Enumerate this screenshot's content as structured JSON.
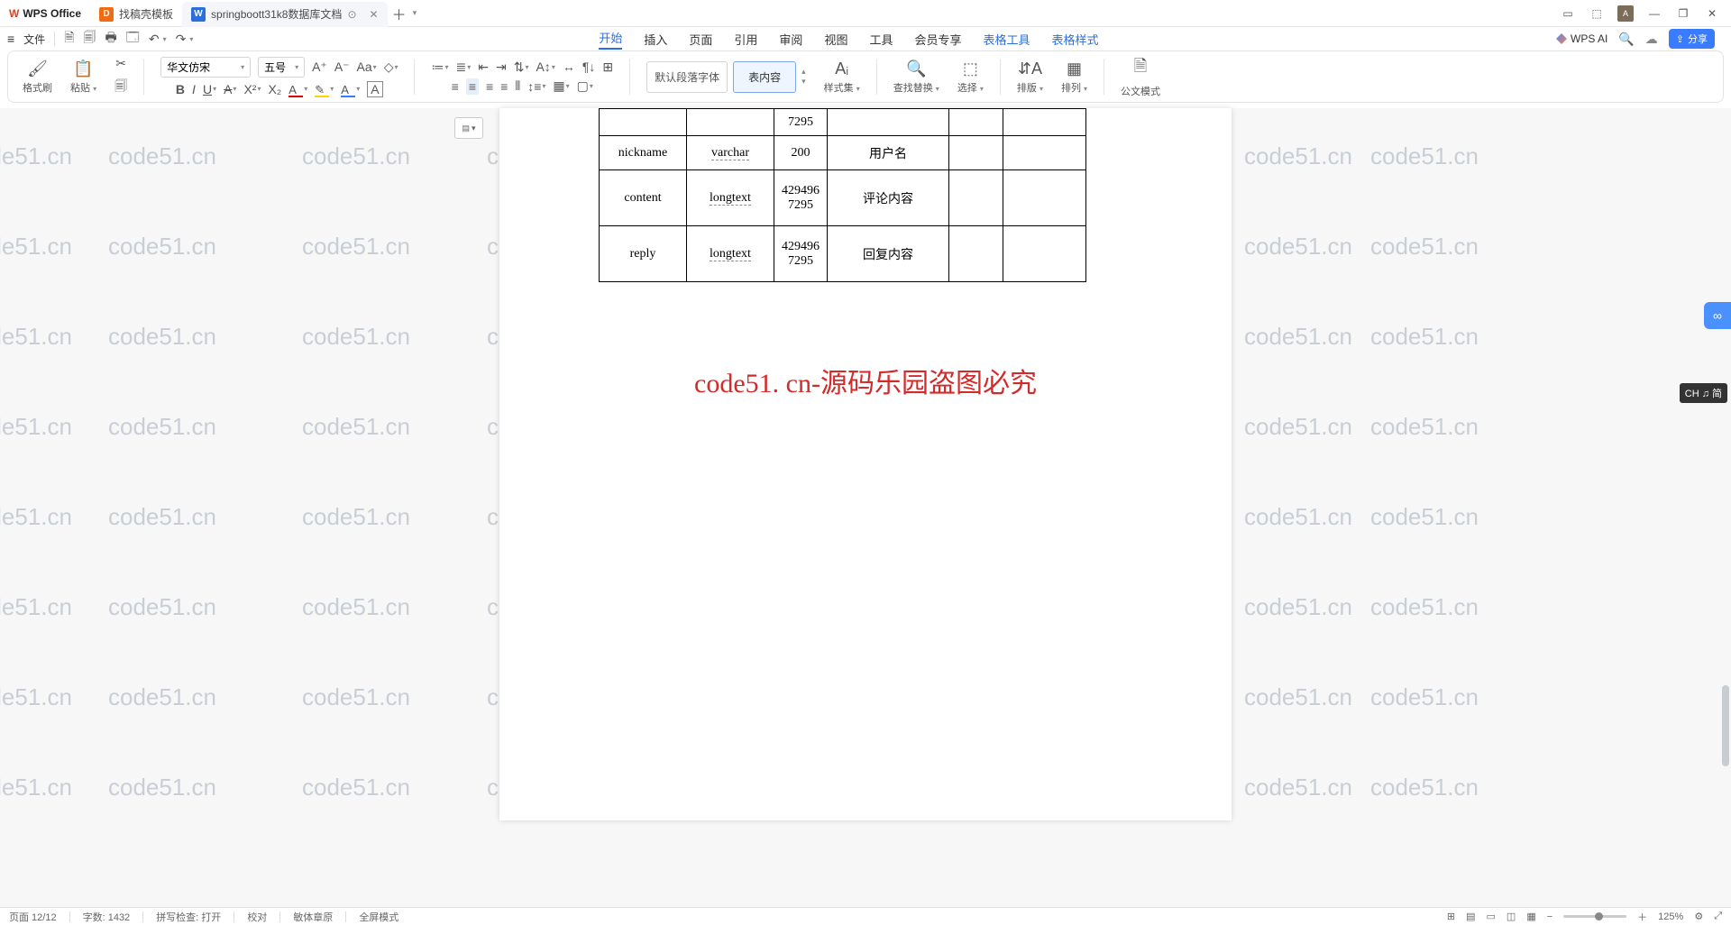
{
  "app": {
    "name": "WPS Office"
  },
  "tabs": [
    {
      "icon": "D",
      "label": "找稿壳模板"
    },
    {
      "icon": "W",
      "label": "springboott31k8数据库文档",
      "active": true
    }
  ],
  "window": {
    "min": "—",
    "max": "❐",
    "close": "✕",
    "pip": "▭",
    "box": "⬚"
  },
  "qat": {
    "file": "文件",
    "undo": "↶",
    "redo": "↷"
  },
  "menu": {
    "items": [
      "开始",
      "插入",
      "页面",
      "引用",
      "审阅",
      "视图",
      "工具",
      "会员专享"
    ],
    "tableTools": "表格工具",
    "tableStyle": "表格样式",
    "active": "开始",
    "wpsai": "WPS AI",
    "share": "分享"
  },
  "ribbon": {
    "formatBrush": "格式刷",
    "paste": "粘贴",
    "font": "华文仿宋",
    "size": "五号",
    "styleDefault": "默认段落字体",
    "styleActive": "表内容",
    "stylesGroup": "样式集",
    "findReplace": "查找替换",
    "select": "选择",
    "arrangeV": "排版",
    "arrangeH": "排列",
    "docMode": "公文模式"
  },
  "table": {
    "rows": [
      {
        "c1": "",
        "c2": "",
        "c3": "7295",
        "c4": "",
        "c5": "",
        "c6": ""
      },
      {
        "c1": "nickname",
        "c2": "varchar",
        "c3": "200",
        "c4": "用户名",
        "c5": "",
        "c6": ""
      },
      {
        "c1": "content",
        "c2": "longtext",
        "c3a": "429496",
        "c3b": "7295",
        "c4": "评论内容",
        "c5": "",
        "c6": ""
      },
      {
        "c1": "reply",
        "c2": "longtext",
        "c3a": "429496",
        "c3b": "7295",
        "c4": "回复内容",
        "c5": "",
        "c6": ""
      }
    ]
  },
  "redHeading": "code51. cn-源码乐园盗图必究",
  "watermark": "code51.cn",
  "ime": "CH ♫ 简",
  "status": {
    "page": "页面 12/12",
    "words": "字数: 1432",
    "spell": "拼写检查: 打开",
    "proof": "校对",
    "aware": "敏体章原",
    "read": "全屏模式",
    "zoom": "125%"
  }
}
